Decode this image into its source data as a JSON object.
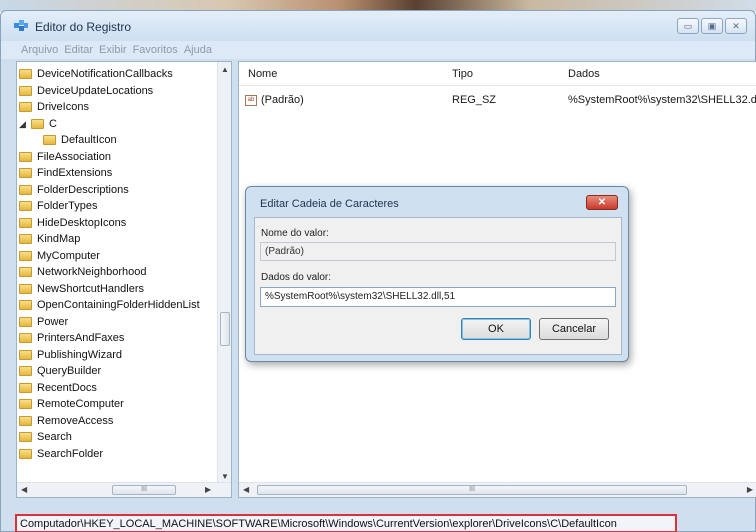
{
  "window": {
    "title": "Editor do Registro",
    "controls": {
      "minimize": "▭",
      "maximize": "▣",
      "close": "✕"
    }
  },
  "menu": [
    "Arquivo",
    "Editar",
    "Exibir",
    "Favoritos",
    "Ajuda"
  ],
  "tree": {
    "items": [
      {
        "label": "DeviceNotificationCallbacks",
        "level": 0
      },
      {
        "label": "DeviceUpdateLocations",
        "level": 0
      },
      {
        "label": "DriveIcons",
        "level": 0
      },
      {
        "label": "C",
        "level": 1,
        "expanded": true
      },
      {
        "label": "DefaultIcon",
        "level": 2
      },
      {
        "label": "FileAssociation",
        "level": 0
      },
      {
        "label": "FindExtensions",
        "level": 0
      },
      {
        "label": "FolderDescriptions",
        "level": 0
      },
      {
        "label": "FolderTypes",
        "level": 0
      },
      {
        "label": "HideDesktopIcons",
        "level": 0
      },
      {
        "label": "KindMap",
        "level": 0
      },
      {
        "label": "MyComputer",
        "level": 0
      },
      {
        "label": "NetworkNeighborhood",
        "level": 0
      },
      {
        "label": "NewShortcutHandlers",
        "level": 0
      },
      {
        "label": "OpenContainingFolderHiddenList",
        "level": 0
      },
      {
        "label": "Power",
        "level": 0
      },
      {
        "label": "PrintersAndFaxes",
        "level": 0
      },
      {
        "label": "PublishingWizard",
        "level": 0
      },
      {
        "label": "QueryBuilder",
        "level": 0
      },
      {
        "label": "RecentDocs",
        "level": 0
      },
      {
        "label": "RemoteComputer",
        "level": 0
      },
      {
        "label": "RemoveAccess",
        "level": 0
      },
      {
        "label": "Search",
        "level": 0
      },
      {
        "label": "SearchFolder",
        "level": 0
      }
    ],
    "scroll_thumb_label": "III"
  },
  "list": {
    "columns": {
      "name": "Nome",
      "type": "Tipo",
      "data": "Dados"
    },
    "rows": [
      {
        "name": "(Padrão)",
        "type": "REG_SZ",
        "data": "%SystemRoot%\\system32\\SHELL32.d"
      }
    ],
    "scroll_thumb_label": "III"
  },
  "status_bar": {
    "path": "Computador\\HKEY_LOCAL_MACHINE\\SOFTWARE\\Microsoft\\Windows\\CurrentVersion\\explorer\\DriveIcons\\C\\DefaultIcon",
    "highlight_color": "#d9323a"
  },
  "dialog": {
    "title": "Editar Cadeia de Caracteres",
    "value_name_label": "Nome do valor:",
    "value_name": "(Padrão)",
    "value_data_label": "Dados do valor:",
    "value_data": "%SystemRoot%\\system32\\SHELL32.dll,51",
    "ok_label": "OK",
    "cancel_label": "Cancelar",
    "close_label": "✕"
  }
}
